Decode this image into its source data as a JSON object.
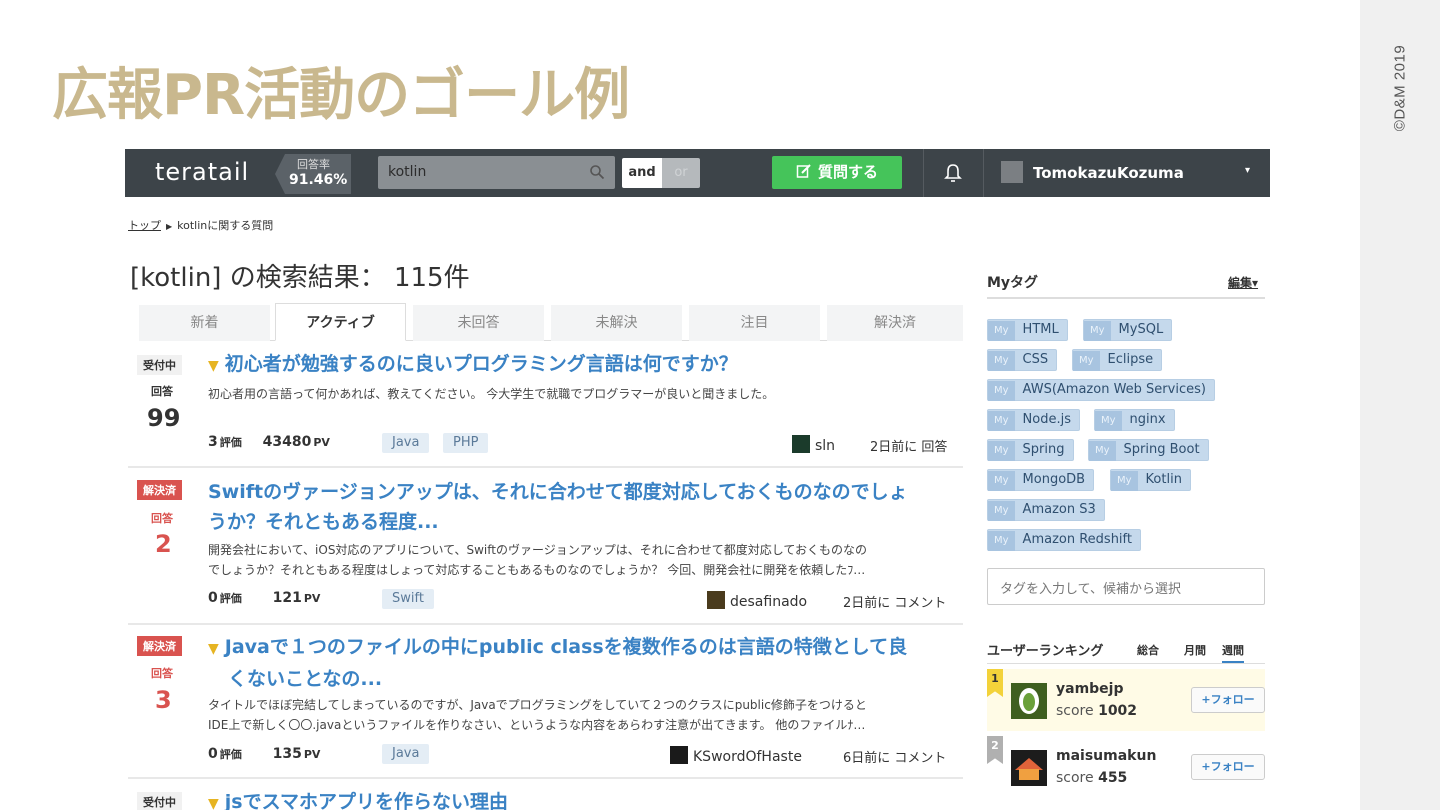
{
  "slide": {
    "title": "広報PR活動のゴール例",
    "copyright": "©D&M 2019"
  },
  "header": {
    "logo": "teratail",
    "rate_label": "回答率",
    "rate_value": "91.46%",
    "search_value": "kotlin",
    "and_label": "and",
    "or_label": "or",
    "ask_label": "質問する",
    "user_name": "TomokazuKozuma",
    "caret": "▾"
  },
  "breadcrumb": {
    "home": "トップ",
    "current": "kotlinに関する質問"
  },
  "result_title": "[kotlin] の検索結果： 115件",
  "tabs": [
    "新着",
    "アクティブ",
    "未回答",
    "未解決",
    "注目",
    "解決済"
  ],
  "questions": [
    {
      "status": "受付中",
      "answer_label": "回答",
      "answer_count": "99",
      "title": "初心者が勉強するのに良いプログラミング言語は何ですか？",
      "excerpt": "初心者用の言語って何かあれば、教えてください。 今大学生で就職でプログラマーが良いと聞きました。",
      "score": "3",
      "score_label": "評価",
      "views": "43480",
      "views_label": "PV",
      "tags": [
        "Java",
        "PHP"
      ],
      "user": "sln",
      "time": "2日前に 回答"
    },
    {
      "status": "解決済",
      "answer_label": "回答",
      "answer_count": "2",
      "title_line1": "Swiftのヴァージョンアップは、それに合わせて都度対応しておくものなのでしょ",
      "title_line2": "うか？それともある程度...",
      "excerpt_line1": "開発会社において、iOS対応のアプリについて、Swiftのヴァージョンアップは、それに合わせて都度対応しておくものなの",
      "excerpt_line2": "でしょうか？それともある程度はしょって対応することもあるものなのでしょうか？ 今回、開発会社に開発を依頼したﾌ…",
      "score": "0",
      "score_label": "評価",
      "views": "121",
      "views_label": "PV",
      "tags": [
        "Swift"
      ],
      "user": "desafinado",
      "time": "2日前に コメント"
    },
    {
      "status": "解決済",
      "answer_label": "回答",
      "answer_count": "3",
      "title_line1": "Javaで１つのファイルの中にpublic classを複数作るのは言語の特徴として良",
      "title_line2": "くないことなの...",
      "excerpt_line1": "タイトルでほぼ完結してしまっているのですが、Javaでプログラミングをしていて２つのクラスにpublic修飾子をつけると",
      "excerpt_line2": "IDE上で新しく〇〇.javaというファイルを作りなさい、というような内容をあらわす注意が出てきます。 他のファイルﾅ…",
      "score": "0",
      "score_label": "評価",
      "views": "135",
      "views_label": "PV",
      "tags": [
        "Java"
      ],
      "user": "KSwordOfHaste",
      "time": "6日前に コメント"
    },
    {
      "status": "受付中",
      "title": "jsでスマホアプリを作らない理由"
    }
  ],
  "sidebar": {
    "mytags_title": "Myタグ",
    "edit_label": "編集▾",
    "my_prefix": "My",
    "mytags": [
      "HTML",
      "MySQL",
      "CSS",
      "Eclipse",
      "AWS(Amazon Web Services)",
      "Node.js",
      "nginx",
      "Spring",
      "Spring Boot",
      "MongoDB",
      "Kotlin",
      "Amazon S3",
      "Amazon Redshift"
    ],
    "tag_input_placeholder": "タグを入力して、候補から選択",
    "ranking_title": "ユーザーランキング",
    "ranking_tabs": [
      "総合",
      "月間",
      "週間"
    ],
    "ranking": [
      {
        "rank": "1",
        "name": "yambejp",
        "score_label": "score",
        "score": "1002",
        "follow": "+フォロー"
      },
      {
        "rank": "2",
        "name": "maisumakun",
        "score_label": "score",
        "score": "455",
        "follow": "+フォロー"
      }
    ]
  },
  "colors": {
    "slide_title": "#c9b88e",
    "header_bg": "#3d4449",
    "ask_button": "#45c45a",
    "link_blue": "#3a82c4",
    "solved_red": "#d9534f",
    "rank1": "#f3d23a",
    "rank2": "#b0b0b0"
  }
}
